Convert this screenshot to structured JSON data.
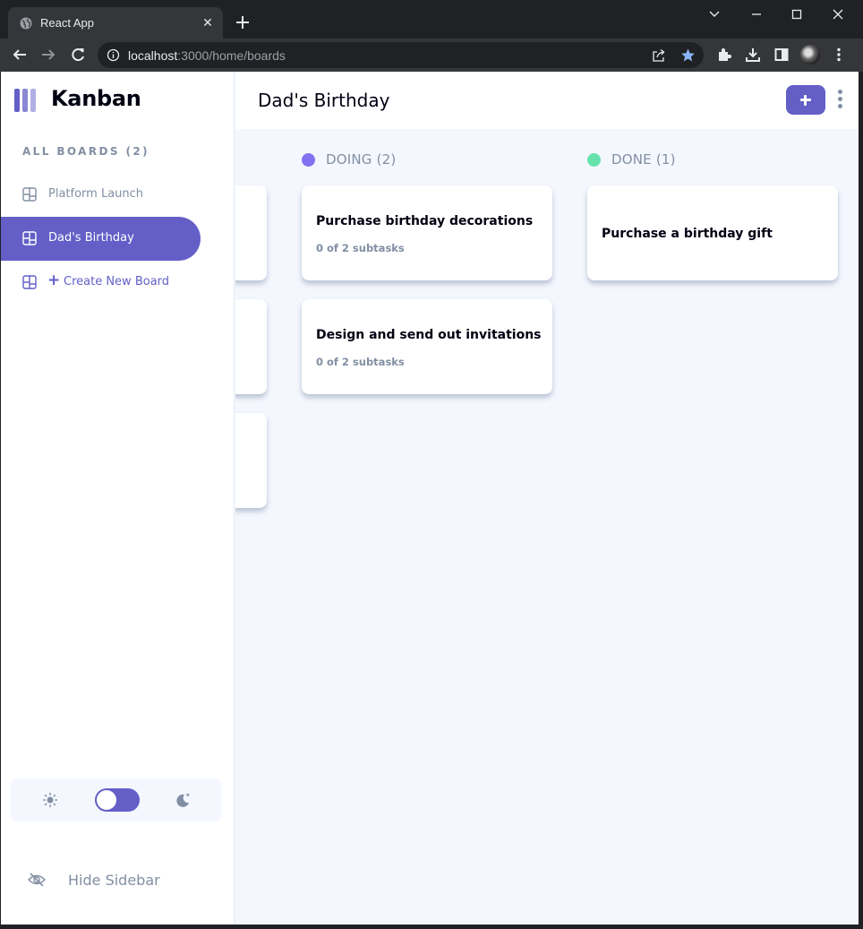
{
  "browser": {
    "tab_title": "React App",
    "url_host": "localhost",
    "url_path": ":3000/home/boards"
  },
  "sidebar": {
    "logo_text": "Kanban",
    "all_boards_label": "ALL BOARDS (2)",
    "boards": [
      {
        "label": "Platform Launch",
        "active": false
      },
      {
        "label": "Dad's Birthday",
        "active": true
      }
    ],
    "create_label": "Create New Board",
    "hide_label": "Hide Sidebar",
    "theme_dark": true
  },
  "header": {
    "title": "Dad's Birthday"
  },
  "columns": [
    {
      "name": "DOING (2)",
      "color": "#8471f2",
      "tasks": [
        {
          "title": "Purchase birthday decorations",
          "subtasks": "0 of 2 subtasks"
        },
        {
          "title": "Design and send out invitations",
          "subtasks": "0 of 2 subtasks"
        }
      ]
    },
    {
      "name": "DONE (1)",
      "color": "#67e2ae",
      "tasks": [
        {
          "title": "Purchase a birthday gift",
          "subtasks": ""
        }
      ]
    }
  ],
  "colors": {
    "accent": "#635fc7",
    "text_muted": "#828fa3",
    "board_bg": "#f4f7fd"
  }
}
